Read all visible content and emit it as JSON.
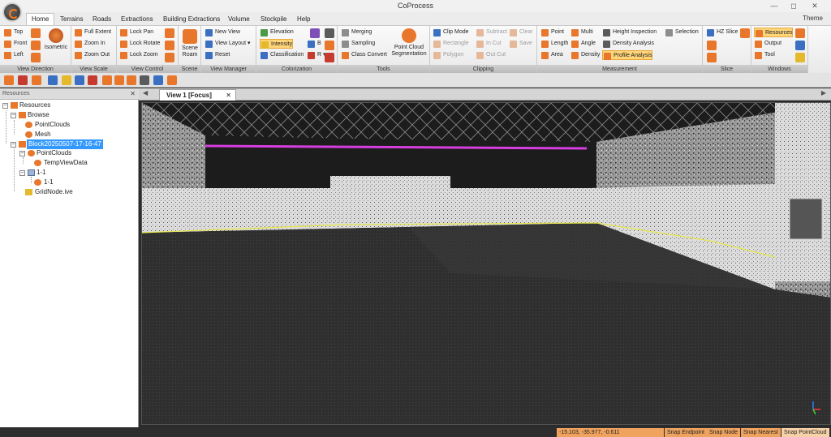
{
  "window": {
    "title": "CoProcess",
    "theme_label": "Theme"
  },
  "tabs": [
    "Home",
    "Terrains",
    "Roads",
    "Extractions",
    "Building Extractions",
    "Volume",
    "Stockpile",
    "Help"
  ],
  "ribbon": {
    "view_direction": {
      "top": "Top",
      "front": "Front",
      "left": "Left",
      "isometric": "Isometric",
      "label": "View Direction"
    },
    "view_scale": {
      "full_extent": "Full Extent",
      "zoom_in": "Zoom In",
      "zoom_out": "Zoom Out",
      "label": "View Scale"
    },
    "view_control": {
      "lock_pan": "Lock Pan",
      "lock_rotate": "Lock Rotate",
      "lock_zoom": "Lock Zoom",
      "label": "View Control"
    },
    "scene": {
      "scene_roam": "Scene Roam",
      "label": "Scene"
    },
    "view_manager": {
      "new_view": "New View",
      "view_layout": "View Layout",
      "reset": "Reset",
      "label": "View Manager"
    },
    "colorization": {
      "elevation": "Elevation",
      "intensity": "Intensity",
      "classification": "Classification",
      "b": "B",
      "r": "R",
      "label": "Colorization"
    },
    "tools": {
      "merging": "Merging",
      "sampling": "Sampling",
      "class_convert": "Class Convert",
      "pcs": "Point Cloud Segmentation",
      "label": "Tools"
    },
    "clipping": {
      "clip_mode": "Clip Mode",
      "subtract": "Subtract",
      "clear": "Clear",
      "rectangle": "Rectangle",
      "in_cut": "In Cut",
      "save": "Save",
      "polygon": "Polygon",
      "out_cut": "Out Cut",
      "label": "Clipping"
    },
    "measurement": {
      "point": "Point",
      "multi": "Multi",
      "height_inspection": "Height Inspection",
      "selection": "Selection",
      "length": "Length",
      "angle": "Angle",
      "density_analysis": "Density Analysis",
      "area": "Area",
      "density": "Density",
      "profile_analysis": "Profile Analysis",
      "label": "Measurement"
    },
    "slice": {
      "hz_slice": "HZ Slice",
      "label": "Slice"
    },
    "windows": {
      "resources": "Resources",
      "output": "Output",
      "tool": "Tool",
      "label": "Windows"
    }
  },
  "panel": {
    "title": "Resources",
    "tree": {
      "root": "Resources",
      "browse": "Browse",
      "pointclouds_1": "PointClouds",
      "mesh": "Mesh",
      "block": "Block20250507-17-16-47",
      "pointclouds_2": "PointClouds",
      "tempviewdata": "TempViewData",
      "group_1_1": "1-1",
      "item_1_1": "1-1",
      "gridnode": "GridNode.ive"
    }
  },
  "view": {
    "tab_label": "View 1 [Focus]"
  },
  "status": {
    "coords": "-15.103, -35.977, -0.611",
    "snap_endpoint": "Snap Endpoint",
    "snap_node": "Snap Node",
    "snap_nearest": "Snap Nearest",
    "snap_pointcloud": "Snap PointCloud"
  }
}
